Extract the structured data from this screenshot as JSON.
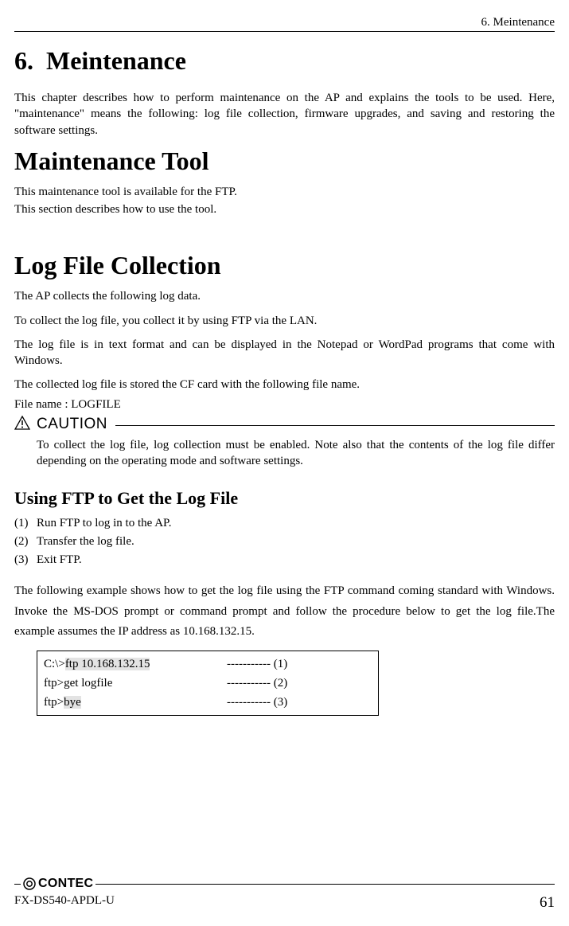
{
  "header": {
    "right": "6. Meintenance"
  },
  "chapter": {
    "number": "6.",
    "title": "Meintenance"
  },
  "intro": "This chapter describes how to perform maintenance on the AP and explains the tools to be used.  Here, \"maintenance\" means the following: log file collection, firmware upgrades, and saving and restoring the software settings.",
  "section1": {
    "title": "Maintenance Tool",
    "p1": "This maintenance tool is available for the FTP.",
    "p2": "This section describes how to use the tool."
  },
  "section2": {
    "title": "Log File Collection",
    "p1": "The AP collects the following log data.",
    "p2": "To collect the log file, you collect it by using FTP via the LAN.",
    "p3": "The log file is in text format and can be displayed in the Notepad or WordPad programs that come with Windows.",
    "p4": "The collected log file is stored the CF card with the following file name.",
    "filename": "File name : LOGFILE"
  },
  "caution": {
    "label": "CAUTION",
    "body": "To collect the log file, log collection must be enabled.  Note also that the contents of the log file differ depending on the operating mode and software settings."
  },
  "sub": {
    "title": "Using FTP to Get the Log File",
    "steps": [
      {
        "n": "(1)",
        "t": "Run FTP to log in to the AP."
      },
      {
        "n": "(2)",
        "t": "Transfer the log file."
      },
      {
        "n": "(3)",
        "t": "Exit FTP."
      }
    ],
    "example_intro": "The following example shows how to get the log file using the FTP command coming standard with Windows. Invoke the MS-DOS prompt or command prompt and follow the procedure below to get the log file.The example assumes the IP address as 10.168.132.15.",
    "cmd": {
      "r1": {
        "prompt": "C:\\>",
        "hl": "ftp 10.168.132.15",
        "mark": "----------- (1)"
      },
      "r2": {
        "prompt": "ftp>get logfile",
        "mark": "----------- (2)"
      },
      "r3": {
        "prompt": "ftp>",
        "hl": "bye",
        "mark": "----------- (3)"
      }
    }
  },
  "footer": {
    "logo": "CONTEC",
    "model": "FX-DS540-APDL-U",
    "page": "61"
  }
}
